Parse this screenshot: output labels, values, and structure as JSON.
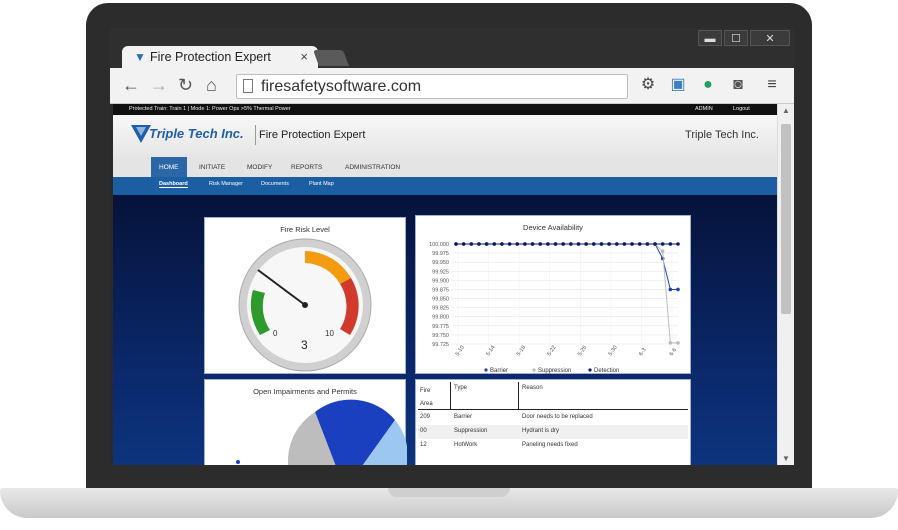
{
  "browser": {
    "tab_title": "Fire Protection Expert",
    "tab_close": "×",
    "url": "firesafetysoftware.com",
    "window_min": "▬",
    "window_max": "☐",
    "window_close": "✕"
  },
  "app": {
    "status_text": "Protected Train: Train 1 | Mode 1: Power Ops >5% Thermal Power",
    "admin_label": "ADMIN",
    "logout_label": "Logout",
    "brand_name": "Triple Tech Inc.",
    "product_name": "Fire Protection Expert",
    "company_name": "Triple Tech Inc.",
    "main_nav": [
      "HOME",
      "INITIATE",
      "MODIFY",
      "REPORTS",
      "ADMINISTRATION"
    ],
    "sub_nav": [
      "Dashboard",
      "Risk Manager",
      "Documents",
      "Plant Map"
    ]
  },
  "gauge": {
    "title": "Fire Risk Level",
    "min_label": "0",
    "max_label": "10",
    "value": 3,
    "value_label": "3"
  },
  "chart_data": {
    "type": "line",
    "title": "Device Availability",
    "x": [
      "5-10",
      "5-14",
      "5-18",
      "5-22",
      "5-26",
      "5-30",
      "6-3",
      "6-6"
    ],
    "y_ticks": [
      "100.000",
      "99.975",
      "99.950",
      "99.925",
      "99.900",
      "99.875",
      "99.850",
      "99.825",
      "99.800",
      "99.775",
      "99.750",
      "99.725"
    ],
    "ylim": [
      99.725,
      100.0
    ],
    "series": [
      {
        "name": "Barrier",
        "color": "#2244aa",
        "values": [
          100,
          100,
          100,
          100,
          100,
          100,
          100,
          100,
          100,
          100,
          100,
          100,
          100,
          100,
          100,
          100,
          100,
          100,
          100,
          100,
          100,
          100,
          100,
          100,
          100,
          100,
          100,
          99.96,
          99.875,
          99.875
        ]
      },
      {
        "name": "Suppression",
        "color": "#bbbbbb",
        "values": [
          100,
          100,
          100,
          100,
          100,
          100,
          100,
          100,
          100,
          100,
          100,
          100,
          100,
          100,
          100,
          100,
          100,
          100,
          100,
          100,
          100,
          100,
          100,
          100,
          100,
          100,
          100,
          99.98,
          99.728,
          99.728
        ]
      },
      {
        "name": "Detection",
        "color": "#0a1a66",
        "values": [
          100,
          100,
          100,
          100,
          100,
          100,
          100,
          100,
          100,
          100,
          100,
          100,
          100,
          100,
          100,
          100,
          100,
          100,
          100,
          100,
          100,
          100,
          100,
          100,
          100,
          100,
          100,
          100,
          100,
          100
        ]
      }
    ]
  },
  "impairments": {
    "title": "Open Impairments and Permits"
  },
  "table": {
    "headers": [
      "Fire Area",
      "Type",
      "Reason"
    ],
    "rows": [
      {
        "area": "209",
        "type": "Barrier",
        "reason": "Door needs to be replaced"
      },
      {
        "area": "00",
        "type": "Suppression",
        "reason": "Hydrant is dry"
      },
      {
        "area": "12",
        "type": "HotWork",
        "reason": "Paneling needs fixed"
      }
    ]
  },
  "colors": {
    "brand_blue": "#1f5fa8",
    "nav_active": "#2b67a6",
    "gauge_green": "#2e9a2e",
    "gauge_orange": "#f39c12",
    "gauge_red": "#d0392b"
  }
}
